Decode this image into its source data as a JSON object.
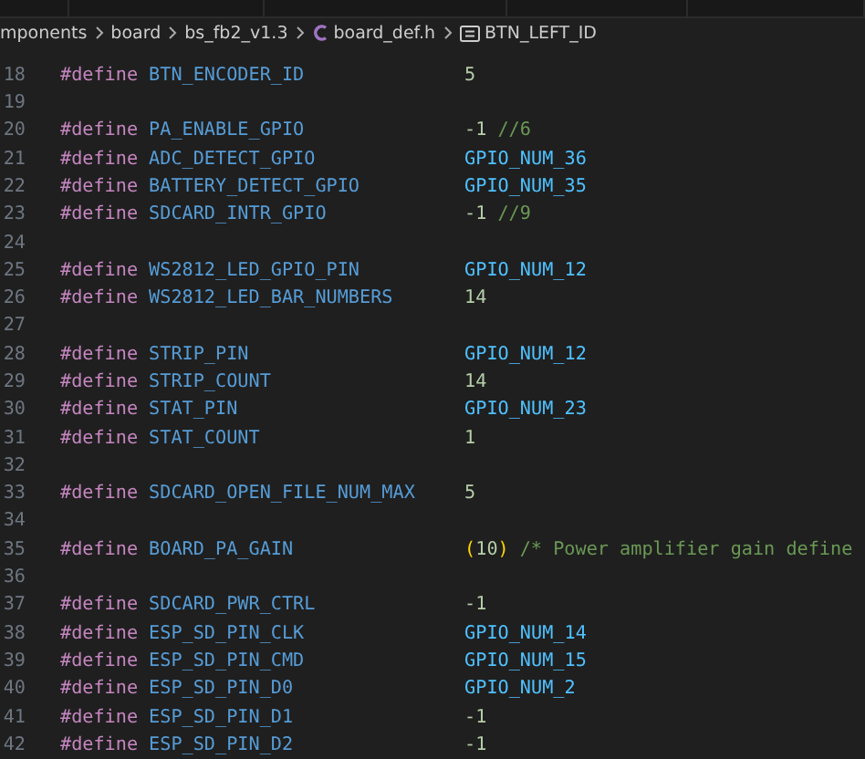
{
  "breadcrumb": [
    {
      "kind": "folder",
      "label": "mponents"
    },
    {
      "kind": "folder",
      "label": "board"
    },
    {
      "kind": "folder",
      "label": "bs_fb2_v1.3"
    },
    {
      "kind": "c-file",
      "label": "board_def.h"
    },
    {
      "kind": "symbol",
      "label": "BTN_LEFT_ID"
    }
  ],
  "lines": [
    {
      "number": "18",
      "directive": "#define",
      "name": "BTN_ENCODER_ID",
      "value": [
        {
          "kind": "number",
          "text": "5"
        }
      ]
    },
    {
      "number": "19"
    },
    {
      "number": "20",
      "directive": "#define",
      "name": "PA_ENABLE_GPIO",
      "value": [
        {
          "kind": "number",
          "text": "-1"
        },
        {
          "kind": "comment",
          "text": "//6"
        }
      ]
    },
    {
      "number": "21",
      "directive": "#define",
      "name": "ADC_DETECT_GPIO",
      "value": [
        {
          "kind": "macro",
          "text": "GPIO_NUM_36"
        }
      ]
    },
    {
      "number": "22",
      "directive": "#define",
      "name": "BATTERY_DETECT_GPIO",
      "value": [
        {
          "kind": "macro",
          "text": "GPIO_NUM_35"
        }
      ]
    },
    {
      "number": "23",
      "directive": "#define",
      "name": "SDCARD_INTR_GPIO",
      "value": [
        {
          "kind": "number",
          "text": "-1"
        },
        {
          "kind": "comment",
          "text": "//9"
        }
      ]
    },
    {
      "number": "24"
    },
    {
      "number": "25",
      "directive": "#define",
      "name": "WS2812_LED_GPIO_PIN",
      "value": [
        {
          "kind": "macro",
          "text": "GPIO_NUM_12"
        }
      ]
    },
    {
      "number": "26",
      "directive": "#define",
      "name": "WS2812_LED_BAR_NUMBERS",
      "value": [
        {
          "kind": "number",
          "text": "14"
        }
      ]
    },
    {
      "number": "27"
    },
    {
      "number": "28",
      "directive": "#define",
      "name": "STRIP_PIN",
      "value": [
        {
          "kind": "macro",
          "text": "GPIO_NUM_12"
        }
      ]
    },
    {
      "number": "29",
      "directive": "#define",
      "name": "STRIP_COUNT",
      "value": [
        {
          "kind": "number",
          "text": "14"
        }
      ]
    },
    {
      "number": "30",
      "directive": "#define",
      "name": "STAT_PIN",
      "value": [
        {
          "kind": "macro",
          "text": "GPIO_NUM_23"
        }
      ]
    },
    {
      "number": "31",
      "directive": "#define",
      "name": "STAT_COUNT",
      "value": [
        {
          "kind": "number",
          "text": "1"
        }
      ]
    },
    {
      "number": "32"
    },
    {
      "number": "33",
      "directive": "#define",
      "name": "SDCARD_OPEN_FILE_NUM_MAX",
      "value": [
        {
          "kind": "number",
          "text": "5"
        }
      ]
    },
    {
      "number": "34"
    },
    {
      "number": "35",
      "directive": "#define",
      "name": "BOARD_PA_GAIN",
      "value": [
        {
          "kind": "paren",
          "text": "("
        },
        {
          "kind": "number",
          "text": "10"
        },
        {
          "kind": "paren",
          "text": ")"
        },
        {
          "kind": "comment",
          "text": "/* Power amplifier gain define"
        }
      ]
    },
    {
      "number": "36"
    },
    {
      "number": "37",
      "directive": "#define",
      "name": "SDCARD_PWR_CTRL",
      "value": [
        {
          "kind": "number",
          "text": "-1"
        }
      ]
    },
    {
      "number": "38",
      "directive": "#define",
      "name": "ESP_SD_PIN_CLK",
      "value": [
        {
          "kind": "macro",
          "text": "GPIO_NUM_14"
        }
      ]
    },
    {
      "number": "39",
      "directive": "#define",
      "name": "ESP_SD_PIN_CMD",
      "value": [
        {
          "kind": "macro",
          "text": "GPIO_NUM_15"
        }
      ]
    },
    {
      "number": "40",
      "directive": "#define",
      "name": "ESP_SD_PIN_D0",
      "value": [
        {
          "kind": "macro",
          "text": "GPIO_NUM_2"
        }
      ]
    },
    {
      "number": "41",
      "directive": "#define",
      "name": "ESP_SD_PIN_D1",
      "value": [
        {
          "kind": "number",
          "text": "-1"
        }
      ]
    },
    {
      "number": "42",
      "directive": "#define",
      "name": "ESP_SD_PIN_D2",
      "value": [
        {
          "kind": "number",
          "text": "-1"
        }
      ]
    }
  ]
}
